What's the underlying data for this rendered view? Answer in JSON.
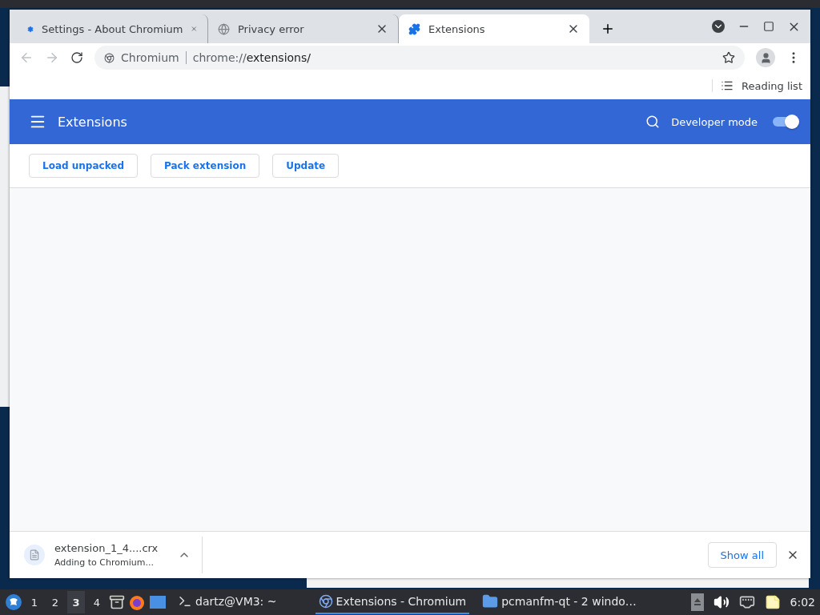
{
  "tabs": [
    {
      "kind": "settings",
      "title": "Settings - About Chromium",
      "selected": false
    },
    {
      "kind": "web",
      "title": "Privacy error",
      "selected": false
    },
    {
      "kind": "extension",
      "title": "Extensions",
      "selected": true
    }
  ],
  "address": {
    "origin": "Chromium",
    "scheme": "chrome://",
    "path": "extensions/"
  },
  "bookmarks": {
    "reading_list": "Reading list"
  },
  "header": {
    "title": "Extensions",
    "developer_mode": {
      "label": "Developer mode",
      "on": true
    }
  },
  "actions": [
    "Load unpacked",
    "Pack extension",
    "Update"
  ],
  "download": {
    "filename": "extension_1_4....crx",
    "status": "Adding to Chromium...",
    "show_all": "Show all"
  },
  "taskbar": {
    "workspaces": [
      {
        "label": "1",
        "selected": false
      },
      {
        "label": "2",
        "selected": false
      },
      {
        "label": "3",
        "selected": true
      },
      {
        "label": "4",
        "selected": false
      }
    ],
    "tasks": [
      {
        "kind": "terminal",
        "label": "dartz@VM3: ~",
        "selected": false
      },
      {
        "kind": "browser",
        "label": "Extensions - Chromium",
        "selected": true
      },
      {
        "kind": "folder",
        "label": "pcmanfm-qt - 2 windo…",
        "selected": false
      }
    ],
    "clock": "6:02"
  }
}
